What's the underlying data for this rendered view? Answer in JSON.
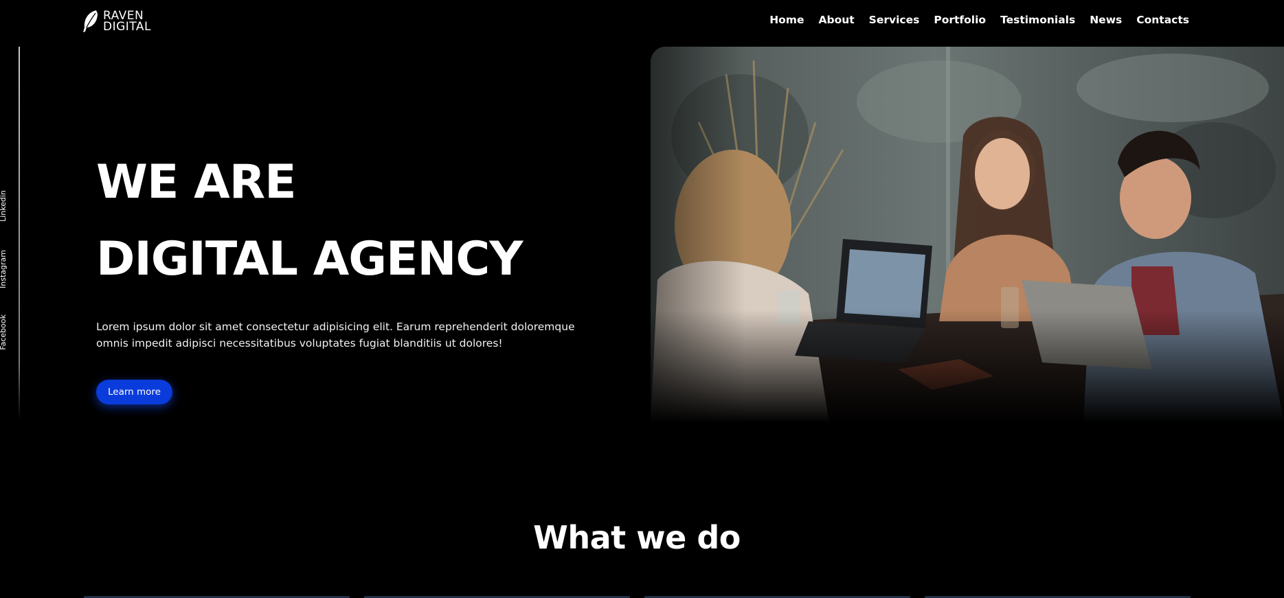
{
  "header": {
    "logo_line1": "RAVEN",
    "logo_line2": "DIGITAL",
    "nav": [
      "Home",
      "About",
      "Services",
      "Portfolio",
      "Testimonials",
      "News",
      "Contacts"
    ]
  },
  "social": {
    "links": [
      "Linkedin",
      "Instagram",
      "Facebook"
    ]
  },
  "hero": {
    "title_line1": "WE ARE",
    "title_line2": "DIGITAL AGENCY",
    "description": "Lorem ipsum dolor sit amet consectetur adipisicing elit. Earum reprehenderit doloremque omnis impedit adipisci necessitatibus voluptates fugiat blanditiis ut dolores!",
    "button_label": "Learn more",
    "image_icon": "team-meeting-photo"
  },
  "section": {
    "title": "What we do",
    "cards_count": 4
  },
  "colors": {
    "background": "#000000",
    "accent": "#0a3cdc",
    "text": "#ffffff"
  }
}
